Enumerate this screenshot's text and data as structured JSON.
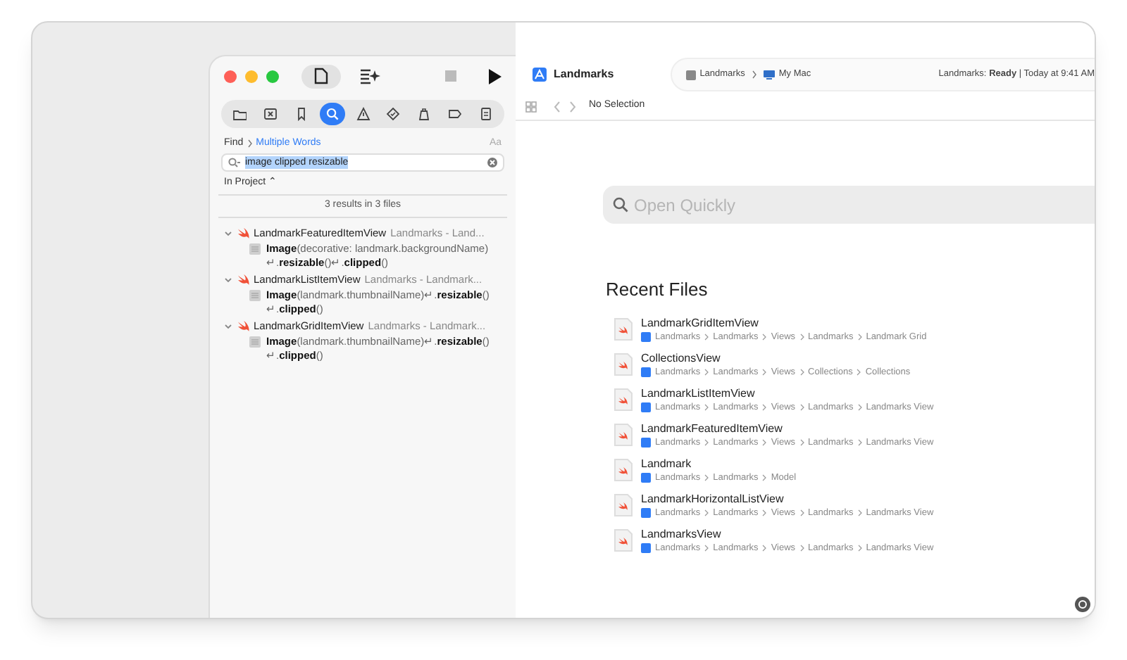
{
  "navigator": {
    "tabs": [
      {
        "kind": "folder",
        "selected": false
      },
      {
        "kind": "source-control",
        "selected": false
      },
      {
        "kind": "bookmark",
        "selected": false
      },
      {
        "kind": "search",
        "selected": true
      },
      {
        "kind": "warning",
        "selected": false
      },
      {
        "kind": "test",
        "selected": false
      },
      {
        "kind": "debug",
        "selected": false
      },
      {
        "kind": "breakpoint",
        "selected": false
      },
      {
        "kind": "report",
        "selected": false
      }
    ],
    "find": {
      "mode": "Find",
      "style": "Multiple Words",
      "case_toggle": "Aa",
      "query": "image clipped resizable",
      "scope": "In Project ⌃",
      "summary": "3 results in 3 files"
    },
    "results": [
      {
        "file": "LandmarkFeaturedItemView",
        "path": "Landmarks - Land...",
        "expanded": true,
        "matches": [
          "**Image**(decorative: landmark.backgroundName)↵.**resizable**()↵.**clipped**()"
        ]
      },
      {
        "file": "LandmarkListItemView",
        "path": "Landmarks - Landmark...",
        "expanded": true,
        "matches": [
          "**Image**(landmark.thumbnailName)↵.**resizable**()↵.**clipped**()"
        ]
      },
      {
        "file": "LandmarkGridItemView",
        "path": "Landmarks - Landmark...",
        "expanded": true,
        "matches": [
          "**Image**(landmark.thumbnailName)↵.**resizable**()↵.**clipped**()"
        ]
      }
    ]
  },
  "toolbar": {
    "project": "Landmarks",
    "scheme": "Landmarks",
    "destination": "My Mac",
    "status": "Landmarks: **Ready** | Today at 9:41 AM"
  },
  "jump_bar": {
    "label": "No Selection"
  },
  "open_quickly": {
    "placeholder": "Open Quickly"
  },
  "recent_files": {
    "title": "Recent Files",
    "files": [
      {
        "name": "LandmarkGridItemView",
        "path": [
          "Landmarks",
          "Landmarks",
          "Views",
          "Landmarks",
          "Landmark Grid"
        ]
      },
      {
        "name": "CollectionsView",
        "path": [
          "Landmarks",
          "Landmarks",
          "Views",
          "Collections",
          "Collections"
        ]
      },
      {
        "name": "LandmarkListItemView",
        "path": [
          "Landmarks",
          "Landmarks",
          "Views",
          "Landmarks",
          "Landmarks View"
        ]
      },
      {
        "name": "LandmarkFeaturedItemView",
        "path": [
          "Landmarks",
          "Landmarks",
          "Views",
          "Landmarks",
          "Landmarks View"
        ]
      },
      {
        "name": "Landmark",
        "path": [
          "Landmarks",
          "Landmarks",
          "Model"
        ]
      },
      {
        "name": "LandmarkHorizontalListView",
        "path": [
          "Landmarks",
          "Landmarks",
          "Views",
          "Landmarks",
          "Landmarks View"
        ]
      },
      {
        "name": "LandmarksView",
        "path": [
          "Landmarks",
          "Landmarks",
          "Views",
          "Landmarks",
          "Landmarks View"
        ]
      }
    ]
  }
}
